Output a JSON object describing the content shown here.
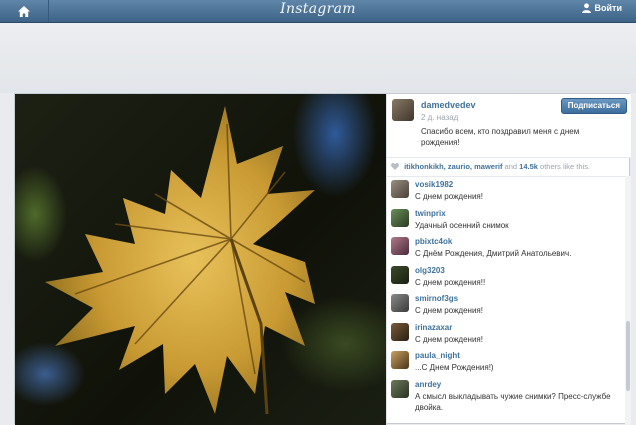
{
  "header": {
    "logo": "Instagram",
    "login_label": "Войти",
    "home_icon": "home-icon",
    "user_icon": "user-icon",
    "bar_color": "#4a7096"
  },
  "post": {
    "author": "damedvedev",
    "time": "2 д. назад",
    "caption": "Спасибо всем, кто поздравил меня с днем рождения!",
    "follow_label": "Подписаться",
    "likes": {
      "heart_icon": "heart-icon",
      "users": "itikhonkikh, zaurio, mawerif",
      "conjunction": "and",
      "count": "14.5k",
      "suffix": "others like this."
    }
  },
  "comments": [
    {
      "user": "vosik1982",
      "text": "С днем рождения!"
    },
    {
      "user": "twinprix",
      "text": "Удачный осенний снимок"
    },
    {
      "user": "pbixtc4ok",
      "text": "С Днём Рождения, Дмитрий Анатольевич."
    },
    {
      "user": "olg3203",
      "text": "С днем рождения!!"
    },
    {
      "user": "smirnof3gs",
      "text": "С днем рождения!"
    },
    {
      "user": "irinazaxar",
      "text": "С днем рождения!"
    },
    {
      "user": "paula_night",
      "text": "...С Днем Рождения!)"
    },
    {
      "user": "anrdey",
      "text": "А смысл выкладывать чужие снимки? Пресс-службе двойка."
    }
  ]
}
